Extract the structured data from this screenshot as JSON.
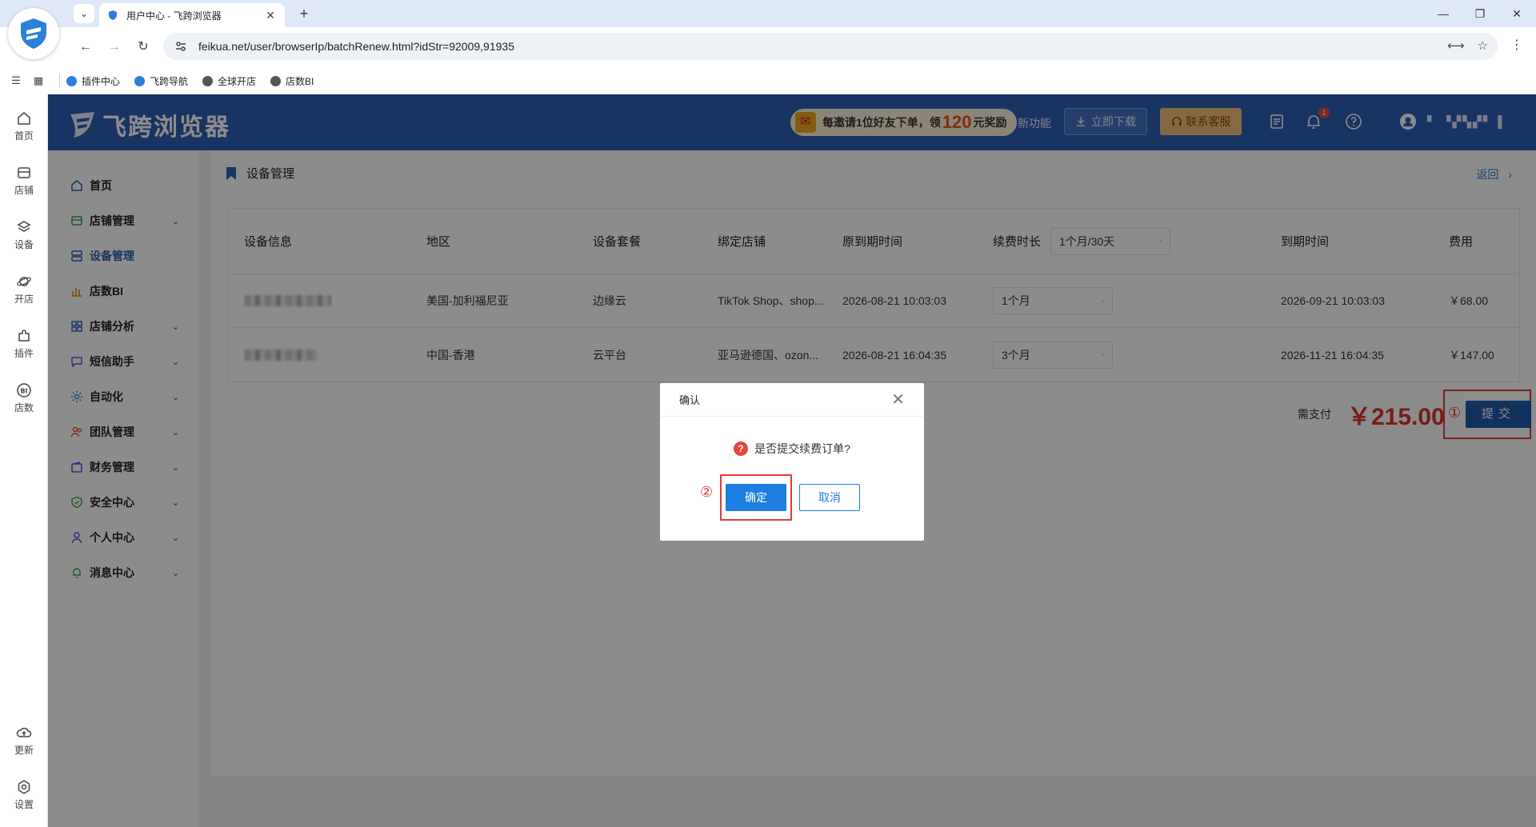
{
  "browser": {
    "tab_title": "用户中心 - 飞跨浏览器",
    "url": "feikua.net/user/browserIp/batchRenew.html?idStr=92009,91935",
    "bookmarks": [
      {
        "label": "插件中心",
        "color": "#2d7fd8"
      },
      {
        "label": "飞跨导航",
        "color": "#2d7fd8"
      },
      {
        "label": "全球开店",
        "color": "#555555"
      },
      {
        "label": "店数BI",
        "color": "#555555"
      }
    ]
  },
  "rail": {
    "items": [
      {
        "label": "首页",
        "icon": "home-icon"
      },
      {
        "label": "店铺",
        "icon": "store-icon"
      },
      {
        "label": "设备",
        "icon": "layers-icon"
      },
      {
        "label": "开店",
        "icon": "planet-icon"
      },
      {
        "label": "插件",
        "icon": "puzzle-icon"
      },
      {
        "label": "店数",
        "icon": "bi-icon"
      }
    ],
    "bottom": [
      {
        "label": "更新",
        "icon": "cloud-upload-icon"
      },
      {
        "label": "设置",
        "icon": "gear-icon"
      }
    ]
  },
  "header": {
    "logo_text": "飞跨浏览器",
    "invite_prefix": "每邀请1位好友下单，领",
    "invite_amount": "120",
    "invite_suffix": "元奖励",
    "new_features": "新功能",
    "download": "立即下载",
    "contact": "联系客服",
    "notification_count": "1",
    "username": "▘ ▝▞▚▞▘ ▌"
  },
  "sidebar": {
    "items": [
      {
        "label": "首页",
        "icon": "home-icon",
        "color": "#2d5fb5",
        "chevron": false,
        "active": false
      },
      {
        "label": "店铺管理",
        "icon": "store-icon",
        "color": "#2fa24a",
        "chevron": true,
        "active": false
      },
      {
        "label": "设备管理",
        "icon": "device-icon",
        "color": "#2d5fb5",
        "chevron": false,
        "active": true
      },
      {
        "label": "店数BI",
        "icon": "chart-icon",
        "color": "#e08a1e",
        "chevron": false,
        "active": false
      },
      {
        "label": "店铺分析",
        "icon": "grid-icon",
        "color": "#2d5fb5",
        "chevron": true,
        "active": false
      },
      {
        "label": "短信助手",
        "icon": "message-icon",
        "color": "#6a4bd1",
        "chevron": true,
        "active": false
      },
      {
        "label": "自动化",
        "icon": "gear-icon",
        "color": "#2d7fd8",
        "chevron": true,
        "active": false
      },
      {
        "label": "团队管理",
        "icon": "team-icon",
        "color": "#e8541e",
        "chevron": true,
        "active": false
      },
      {
        "label": "财务管理",
        "icon": "wallet-icon",
        "color": "#6a4bd1",
        "chevron": true,
        "active": false
      },
      {
        "label": "安全中心",
        "icon": "shield-icon",
        "color": "#2fa24a",
        "chevron": true,
        "active": false
      },
      {
        "label": "个人中心",
        "icon": "user-icon",
        "color": "#6a4bd1",
        "chevron": true,
        "active": false
      },
      {
        "label": "消息中心",
        "icon": "bell-icon",
        "color": "#2fa24a",
        "chevron": true,
        "active": false
      }
    ]
  },
  "page": {
    "title": "设备管理",
    "back": "返回",
    "table": {
      "headers": {
        "device": "设备信息",
        "region": "地区",
        "plan": "设备套餐",
        "store": "绑定店铺",
        "orig_expire": "原到期时间",
        "duration": "续费时长",
        "duration_all": "1个月/30天",
        "new_expire": "到期时间",
        "fee": "费用"
      },
      "rows": [
        {
          "region": "美国-加利福尼亚",
          "plan": "边缘云",
          "store": "TikTok Shop、shop...",
          "orig_expire": "2026-08-21 10:03:03",
          "duration": "1个月",
          "new_expire": "2026-09-21 10:03:03",
          "fee": "￥68.00"
        },
        {
          "region": "中国-香港",
          "plan": "云平台",
          "store": "亚马逊德国、ozon...",
          "orig_expire": "2026-08-21 16:04:35",
          "duration": "3个月",
          "new_expire": "2026-11-21 16:04:35",
          "fee": "￥147.00"
        }
      ]
    },
    "pay_label": "需支付",
    "pay_amount": "￥215.00",
    "submit": "提交",
    "marker1": "①"
  },
  "dialog": {
    "title": "确认",
    "message": "是否提交续费订单?",
    "ok": "确定",
    "cancel": "取消",
    "marker2": "②"
  }
}
